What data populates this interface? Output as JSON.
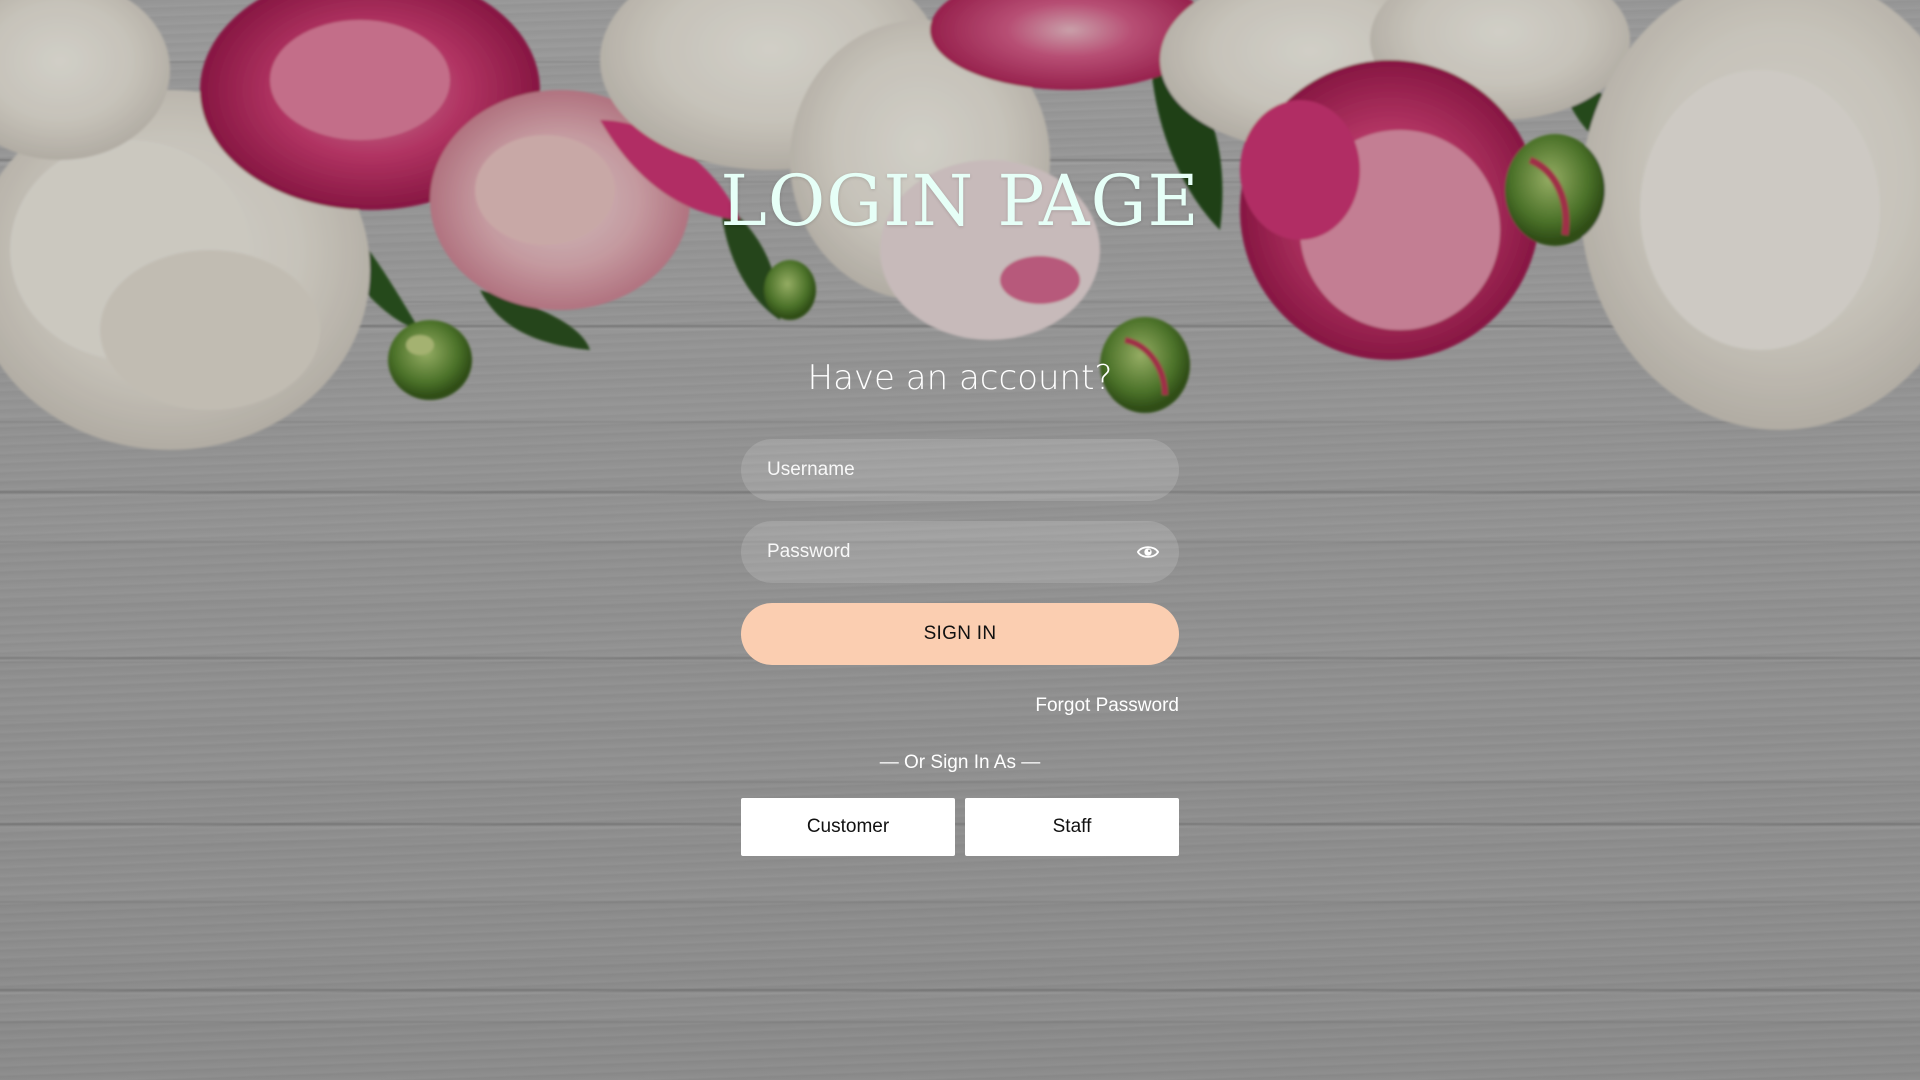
{
  "page": {
    "title": "LOGIN PAGE",
    "subtitle": "Have an account?"
  },
  "form": {
    "username_placeholder": "Username",
    "password_placeholder": "Password",
    "show_password_icon": "eye-icon",
    "signin_label": "SIGN IN",
    "forgot_label": "Forgot Password",
    "divider_text": "— Or Sign In As —",
    "roles": [
      "Customer",
      "Staff"
    ]
  },
  "colors": {
    "signin_button": "#fbceb1",
    "title": "#e6fff7"
  }
}
